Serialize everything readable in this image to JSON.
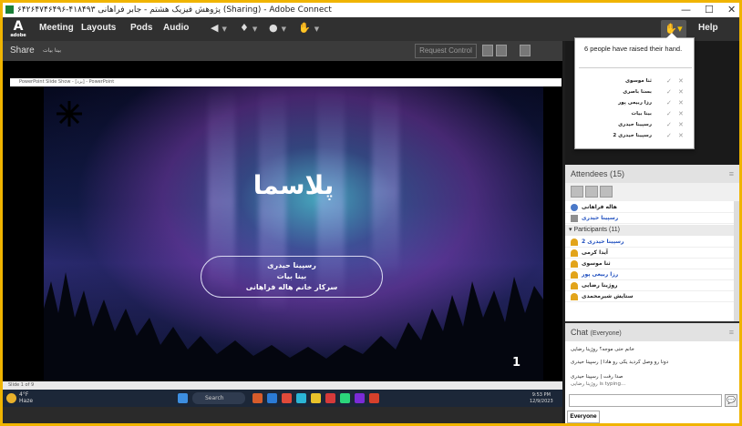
{
  "window": {
    "title": "۶۴۲۶۴۷۴۶۴۹۶-۴۱۸۴۹۳ پژوهش فیزیک هشتم - جابر فراهانی (Sharing) - Adobe Connect",
    "minimize": "—",
    "maximize": "☐",
    "close": "✕"
  },
  "menubar": {
    "logo": "A",
    "logo_sub": "adobe",
    "items": [
      "Meeting",
      "Layouts",
      "Pods",
      "Audio"
    ],
    "help": "Help",
    "icons": [
      "speaker-icon",
      "microphone-icon",
      "camera-icon",
      "raise-hand-icon"
    ]
  },
  "share": {
    "label": "Share",
    "presenter": "بینا بیات",
    "request_control": "Request Control",
    "ppt_title": "PowerPoint Slide Show - [یزد]  -  PowerPoint",
    "slide_title": "پلاسما",
    "names": [
      "رسپینا حیدری",
      "بینا بیات",
      "سرکار خانم هاله فراهانی"
    ],
    "slide_number": "1",
    "slide_status": "Slide 1 of 9"
  },
  "taskbar": {
    "weather_temp": "4°F",
    "weather_label": "Haze",
    "search": "Search",
    "time": "9:53 PM",
    "date": "12/9/2023"
  },
  "raised_hands": {
    "title": "6 people have raised their hand.",
    "people": [
      "ثنا موسوی",
      "بسنا باصری",
      "رزا ربیعی پور",
      "بینا بیات",
      "رسپینا حیدری",
      "رسپینا حیدری 2"
    ],
    "accept_glyph": "✓",
    "dismiss_glyph": "✕"
  },
  "attendees": {
    "header": "Attendees",
    "count": "(15)",
    "hosts": [
      "هاله فراهانی",
      "رسپینا حیدری"
    ],
    "participants_label": "Participants (11)",
    "participants": [
      "رسپینا حیدری 2",
      "آیدا کرمی",
      "ثنا موسوی",
      "رزا ربیعی پور",
      "روژینا رضایی",
      "ستایش شیرمحمدی"
    ]
  },
  "chat": {
    "header": "Chat",
    "scope": "(Everyone)",
    "messages": [
      "خانم حتی موجه؟ روژینا رضایی",
      "دونا رو وصل کردید یکی رو هادا | رسپینا حیدری",
      "صدا رفت | رسپینا حیدری",
      "روژینا رضایی is typing..."
    ],
    "tab": "Everyone",
    "send_icon": "💬"
  },
  "colors": {
    "accent_yellow": "#f0b400",
    "chrome_dark": "#303030",
    "link_blue": "#1f4fbf"
  }
}
